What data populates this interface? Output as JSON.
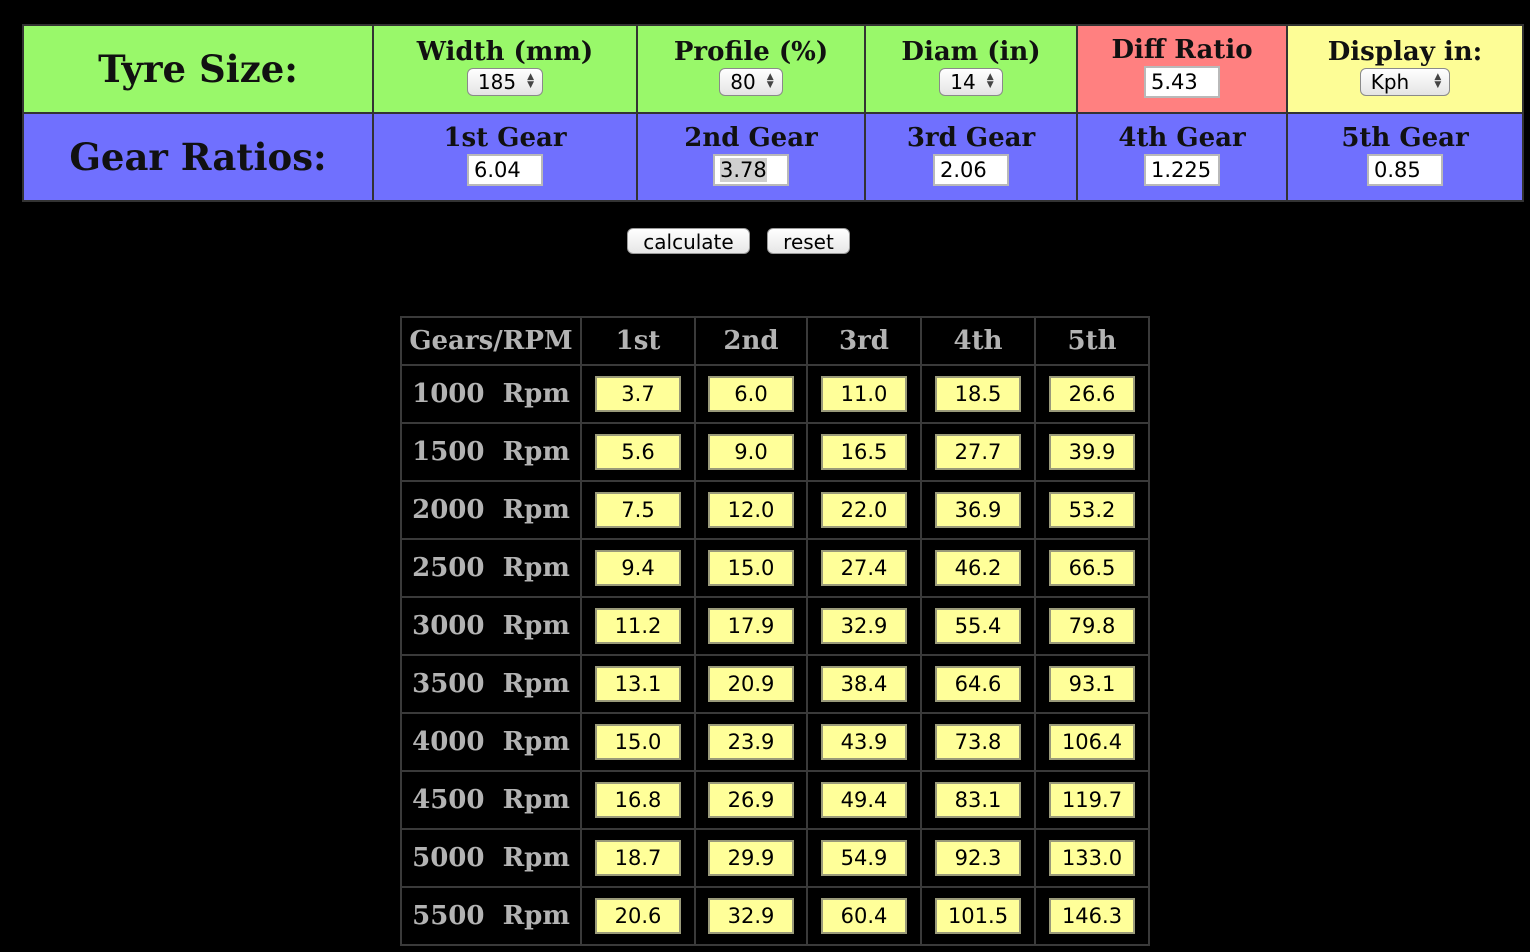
{
  "settings": {
    "tyre_heading": "Tyre Size:",
    "width": {
      "label": "Width (mm)",
      "value": "185"
    },
    "profile": {
      "label": "Profile (%)",
      "value": "80"
    },
    "diameter": {
      "label": "Diam (in)",
      "value": "14"
    },
    "diff": {
      "label": "Diff Ratio",
      "value": "5.43"
    },
    "display": {
      "label": "Display in:",
      "value": "Kph"
    },
    "gear_heading": "Gear Ratios:",
    "gears": [
      {
        "label": "1st Gear",
        "value": "6.04"
      },
      {
        "label": "2nd Gear",
        "value": "3.78"
      },
      {
        "label": "3rd Gear",
        "value": "2.06"
      },
      {
        "label": "4th Gear",
        "value": "1.225"
      },
      {
        "label": "5th Gear",
        "value": "0.85"
      }
    ]
  },
  "buttons": {
    "calculate": "calculate",
    "reset": "reset"
  },
  "results": {
    "headers": [
      "Gears/RPM",
      "1st",
      "2nd",
      "3rd",
      "4th",
      "5th"
    ],
    "rows": [
      {
        "label": "1000  Rpm",
        "values": [
          "3.7",
          "6.0",
          "11.0",
          "18.5",
          "26.6"
        ]
      },
      {
        "label": "1500  Rpm",
        "values": [
          "5.6",
          "9.0",
          "16.5",
          "27.7",
          "39.9"
        ]
      },
      {
        "label": "2000  Rpm",
        "values": [
          "7.5",
          "12.0",
          "22.0",
          "36.9",
          "53.2"
        ]
      },
      {
        "label": "2500  Rpm",
        "values": [
          "9.4",
          "15.0",
          "27.4",
          "46.2",
          "66.5"
        ]
      },
      {
        "label": "3000  Rpm",
        "values": [
          "11.2",
          "17.9",
          "32.9",
          "55.4",
          "79.8"
        ]
      },
      {
        "label": "3500  Rpm",
        "values": [
          "13.1",
          "20.9",
          "38.4",
          "64.6",
          "93.1"
        ]
      },
      {
        "label": "4000  Rpm",
        "values": [
          "15.0",
          "23.9",
          "43.9",
          "73.8",
          "106.4"
        ]
      },
      {
        "label": "4500  Rpm",
        "values": [
          "16.8",
          "26.9",
          "49.4",
          "83.1",
          "119.7"
        ]
      },
      {
        "label": "5000  Rpm",
        "values": [
          "18.7",
          "29.9",
          "54.9",
          "92.3",
          "133.0"
        ]
      },
      {
        "label": "5500  Rpm",
        "values": [
          "20.6",
          "32.9",
          "60.4",
          "101.5",
          "146.3"
        ]
      }
    ]
  }
}
